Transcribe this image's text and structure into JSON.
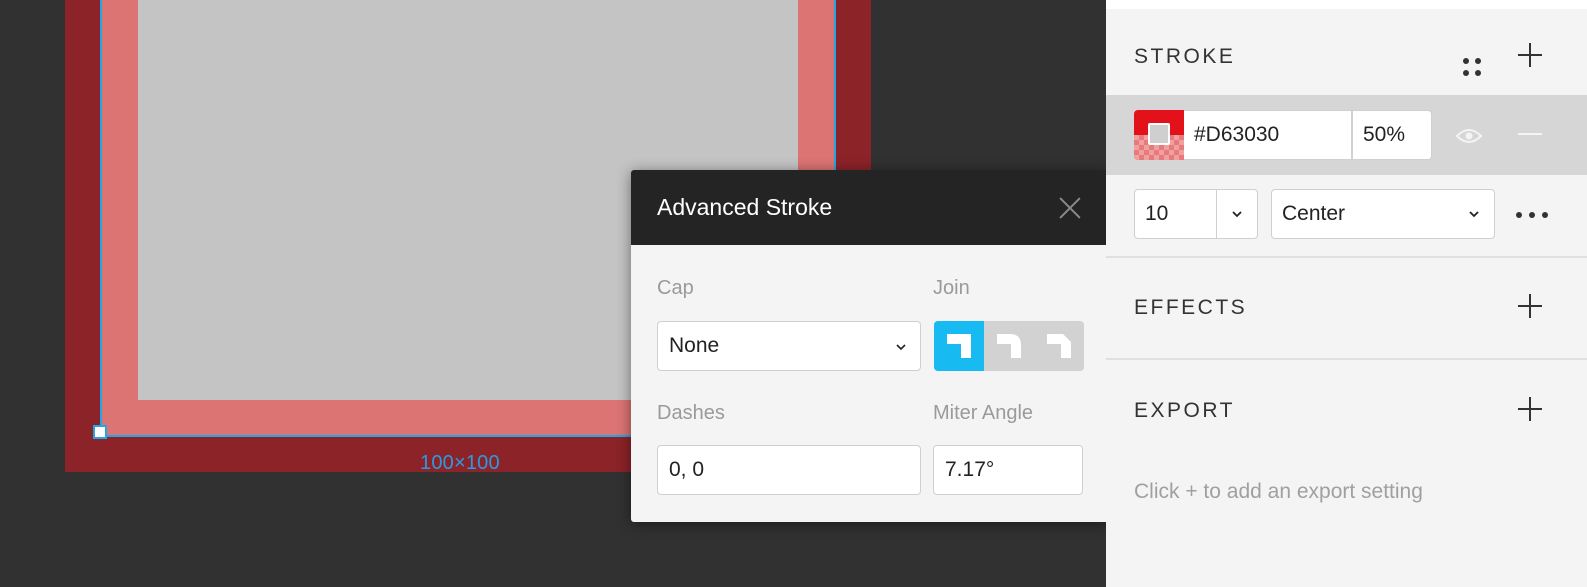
{
  "canvas": {
    "dimension_label": "100×100"
  },
  "advanced_stroke": {
    "title": "Advanced Stroke",
    "cap_label": "Cap",
    "cap_value": "None",
    "join_label": "Join",
    "join_options": [
      "miter-join-icon",
      "round-join-icon",
      "bevel-join-icon"
    ],
    "join_selected": "miter",
    "dashes_label": "Dashes",
    "dashes_value": "0, 0",
    "miter_label": "Miter Angle",
    "miter_value": "7.17°"
  },
  "panel": {
    "stroke": {
      "title": "STROKE",
      "color_hex": "#D63030",
      "opacity": "50%",
      "width": "10",
      "align": "Center"
    },
    "effects": {
      "title": "EFFECTS"
    },
    "export": {
      "title": "EXPORT",
      "hint": "Click + to add an export setting"
    }
  },
  "colors": {
    "canvas_bg": "#313131",
    "stroke_outer": "#8b2329",
    "stroke_inner": "#dc7473",
    "shape_fill": "#c4c4c4",
    "selection": "#21a7e6",
    "accent": "#18baf2",
    "swatch_red": "#e3111a"
  }
}
